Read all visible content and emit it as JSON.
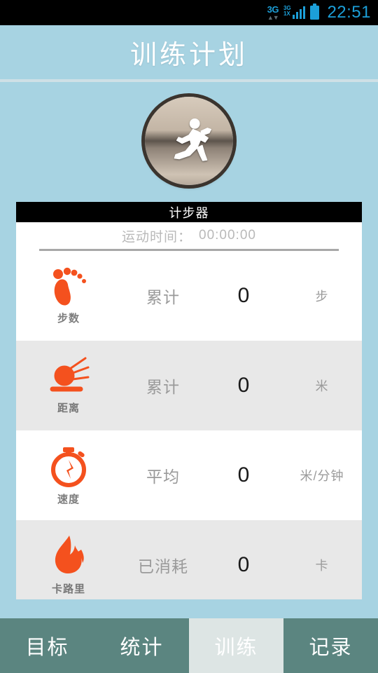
{
  "statusbar": {
    "network_label": "3G",
    "network_arrows": "▲▼",
    "signal_tag_top": "3G",
    "signal_tag_bottom": "1X",
    "time": "22:51",
    "accent_color": "#1c9fd8"
  },
  "header": {
    "title": "训练计划"
  },
  "badge": {
    "icon": "runner-icon"
  },
  "card": {
    "title": "计步器",
    "timer_label": "运动时间：",
    "timer_value": "00:00:00",
    "rows": [
      {
        "icon": "footprint-icon",
        "icon_label": "步数",
        "label": "累计",
        "value": "0",
        "unit": "步"
      },
      {
        "icon": "comet-icon",
        "icon_label": "距离",
        "label": "累计",
        "value": "0",
        "unit": "米"
      },
      {
        "icon": "stopwatch-icon",
        "icon_label": "速度",
        "label": "平均",
        "value": "0",
        "unit": "米/分钟"
      },
      {
        "icon": "flame-icon",
        "icon_label": "卡路里",
        "label": "已消耗",
        "value": "0",
        "unit": "卡"
      }
    ],
    "accent_icon_color": "#f4511e"
  },
  "tabbar": {
    "tabs": [
      {
        "label": "目标",
        "active": false
      },
      {
        "label": "统计",
        "active": false
      },
      {
        "label": "训练",
        "active": true
      },
      {
        "label": "记录",
        "active": false
      }
    ],
    "background_color": "#5b8580",
    "active_background_color": "#dde5e4"
  }
}
